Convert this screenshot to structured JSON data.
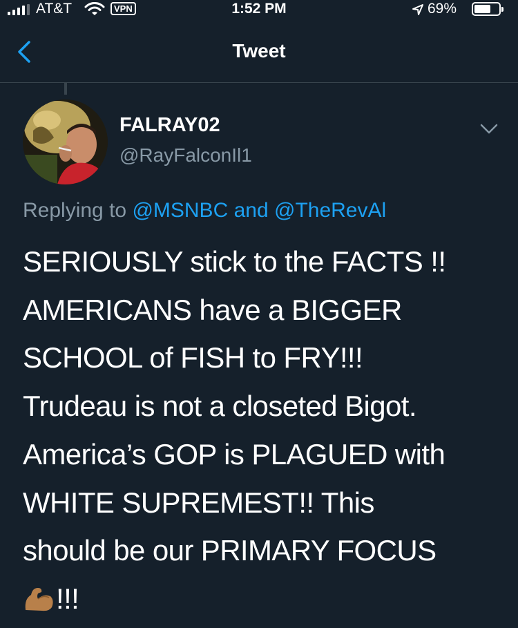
{
  "status_bar": {
    "carrier": "AT&T",
    "vpn_label": "VPN",
    "time": "1:52 PM",
    "battery_percent_text": "69%",
    "battery_level": 0.69,
    "icons": [
      "signal-icon",
      "wifi-icon",
      "location-arrow-icon",
      "battery-icon"
    ]
  },
  "nav": {
    "title": "Tweet",
    "back_icon": "chevron-left-icon"
  },
  "tweet": {
    "author_name": "FALRAY02",
    "author_handle": "@RayFalconIl1",
    "replying_prefix": "Replying to",
    "reply_targets": [
      "@MSNBC",
      "@TheRevAl"
    ],
    "reply_joiner": "and",
    "body_lines": [
      "SERIOUSLY stick to the FACTS !!",
      "AMERICANS have a BIGGER",
      "SCHOOL of FISH to FRY!!!",
      "Trudeau is not a closeted Bigot.",
      "America’s GOP is PLAGUED with",
      "WHITE SUPREMEST!! This",
      "should be our PRIMARY FOCUS",
      "!!!"
    ],
    "trailing_emoji": "flexed-biceps-icon",
    "menu_icon": "chevron-down-icon"
  },
  "colors": {
    "background": "#15202b",
    "text": "#ffffff",
    "secondary_text": "#8899a6",
    "accent": "#1da1f2",
    "divider": "#38444d"
  }
}
